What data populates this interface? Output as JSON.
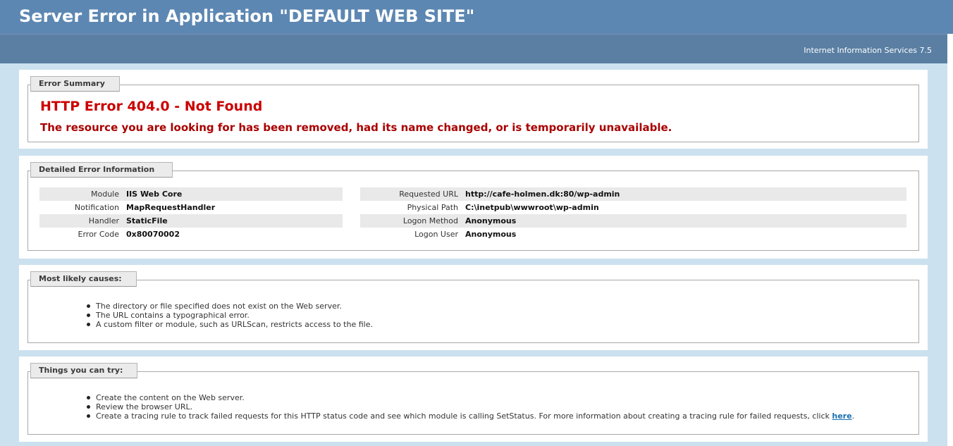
{
  "header": {
    "title": "Server Error in Application \"DEFAULT WEB SITE\"",
    "server_version": "Internet Information Services 7.5"
  },
  "error_summary": {
    "legend": "Error Summary",
    "title": "HTTP Error 404.0 - Not Found",
    "description": "The resource you are looking for has been removed, had its name changed, or is temporarily unavailable."
  },
  "detailed_info": {
    "legend": "Detailed Error Information",
    "left_rows": [
      {
        "label": "Module",
        "value": "IIS Web Core"
      },
      {
        "label": "Notification",
        "value": "MapRequestHandler"
      },
      {
        "label": "Handler",
        "value": "StaticFile"
      },
      {
        "label": "Error Code",
        "value": "0x80070002"
      }
    ],
    "right_rows": [
      {
        "label": "Requested URL",
        "value": "http://cafe-holmen.dk:80/wp-admin"
      },
      {
        "label": "Physical Path",
        "value": "C:\\inetpub\\wwwroot\\wp-admin"
      },
      {
        "label": "Logon Method",
        "value": "Anonymous"
      },
      {
        "label": "Logon User",
        "value": "Anonymous"
      }
    ]
  },
  "causes": {
    "legend": "Most likely causes:",
    "items": [
      "The directory or file specified does not exist on the Web server.",
      "The URL contains a typographical error.",
      "A custom filter or module, such as URLScan, restricts access to the file."
    ]
  },
  "try": {
    "legend": "Things you can try:",
    "items": [
      "Create the content on the Web server.",
      "Review the browser URL.",
      "Create a tracing rule to track failed requests for this HTTP status code and see which module is calling SetStatus. For more information about creating a tracing rule for failed requests, click "
    ],
    "link_text": "here",
    "link_suffix": "."
  },
  "colors": {
    "header_bg": "#5c87b2",
    "subheader_bg": "#5a7fa3",
    "page_bg": "#cbe1ef",
    "error_red": "#cc0000",
    "link_blue": "#1a6fb0"
  }
}
